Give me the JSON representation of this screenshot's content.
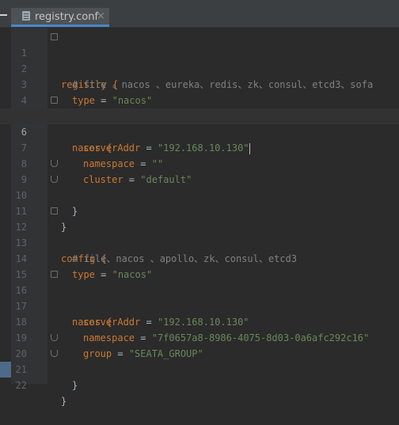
{
  "tab": {
    "filename": "registry.conf",
    "close": "×"
  },
  "lines": [
    {
      "n": "1",
      "text": "registry {"
    },
    {
      "n": "2",
      "text": "# file 、nacos 、eureka、redis、zk、consul、etcd3、sofa"
    },
    {
      "n": "3",
      "key": "type",
      "op": " = ",
      "val": "\"nacos\""
    },
    {
      "n": "4"
    },
    {
      "n": "5",
      "text": "nacos {"
    },
    {
      "n": "6",
      "key": "serverAddr",
      "op": " = ",
      "val": "\"192.168.10.130\""
    },
    {
      "n": "7",
      "key": "namespace",
      "op": " = ",
      "val": "\"\""
    },
    {
      "n": "8",
      "key": "cluster",
      "op": " = ",
      "val": "\"default\""
    },
    {
      "n": "9",
      "text": "}"
    },
    {
      "n": "10",
      "text": "}"
    },
    {
      "n": "11"
    },
    {
      "n": "12",
      "text": "config {"
    },
    {
      "n": "13",
      "text": "# file、nacos 、apollo、zk、consul、etcd3"
    },
    {
      "n": "14",
      "key": "type",
      "op": " = ",
      "val": "\"nacos\""
    },
    {
      "n": "15"
    },
    {
      "n": "16",
      "text": "nacos {"
    },
    {
      "n": "17",
      "key": "serverAddr",
      "op": " = ",
      "val": "\"192.168.10.130\""
    },
    {
      "n": "18",
      "key": "namespace",
      "op": " = ",
      "val": "\"7f0657a8-8986-4075-8d03-0a6afc292c16\""
    },
    {
      "n": "19",
      "key": "group",
      "op": " = ",
      "val": "\"SEATA_GROUP\""
    },
    {
      "n": "20",
      "text": "}"
    },
    {
      "n": "21",
      "text": "}"
    },
    {
      "n": "22"
    }
  ],
  "colors": {
    "background": "#2b2b2b",
    "keyword": "#cc7832",
    "string": "#6a8759",
    "comment": "#808080",
    "text": "#a9b7c6"
  }
}
